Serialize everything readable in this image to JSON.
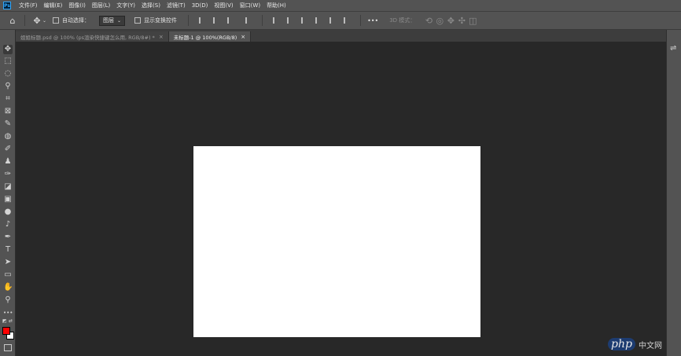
{
  "app": {
    "logo_text": "Ps"
  },
  "menu": [
    "文件(F)",
    "编辑(E)",
    "图像(I)",
    "图层(L)",
    "文字(Y)",
    "选择(S)",
    "滤镜(T)",
    "3D(D)",
    "视图(V)",
    "窗口(W)",
    "帮助(H)"
  ],
  "options_bar": {
    "auto_select_label": "自动选择：",
    "auto_select_value": "图层",
    "show_transform_label": "显示变换控件",
    "more": "•••",
    "mode_3d_label": "3D 模式："
  },
  "tabs": [
    {
      "label": "姐姐标题.psd @ 100% (ps渲染快捷键怎么用, RGB/8#) *",
      "active": false,
      "close": "×"
    },
    {
      "label": "未标题-1 @ 100%(RGB/8)",
      "active": true,
      "close": "×"
    }
  ],
  "tools": [
    {
      "name": "move-tool",
      "glyph": "✥"
    },
    {
      "name": "marquee-tool",
      "glyph": "⬚"
    },
    {
      "name": "lasso-tool",
      "glyph": "◌"
    },
    {
      "name": "quick-select-tool",
      "glyph": "⚲"
    },
    {
      "name": "crop-tool",
      "glyph": "⌗"
    },
    {
      "name": "frame-tool",
      "glyph": "⊠"
    },
    {
      "name": "eyedropper-tool",
      "glyph": "✎"
    },
    {
      "name": "healing-tool",
      "glyph": "◍"
    },
    {
      "name": "brush-tool",
      "glyph": "✐"
    },
    {
      "name": "stamp-tool",
      "glyph": "♟"
    },
    {
      "name": "history-brush-tool",
      "glyph": "✑"
    },
    {
      "name": "eraser-tool",
      "glyph": "◪"
    },
    {
      "name": "gradient-tool",
      "glyph": "▣"
    },
    {
      "name": "blur-tool",
      "glyph": "●"
    },
    {
      "name": "dodge-tool",
      "glyph": "♪"
    },
    {
      "name": "pen-tool",
      "glyph": "✒"
    },
    {
      "name": "type-tool",
      "glyph": "T"
    },
    {
      "name": "path-select-tool",
      "glyph": "➤"
    },
    {
      "name": "shape-tool",
      "glyph": "▭"
    },
    {
      "name": "hand-tool",
      "glyph": "✋"
    },
    {
      "name": "zoom-tool",
      "glyph": "⚲"
    },
    {
      "name": "more-tools",
      "glyph": "•••"
    }
  ],
  "colors": {
    "foreground": "#ff0000",
    "background": "#ffffff",
    "canvas": "#ffffff",
    "workspace": "#282828",
    "chrome": "#535353"
  },
  "watermark": {
    "logo": "php",
    "text": "中文网"
  }
}
